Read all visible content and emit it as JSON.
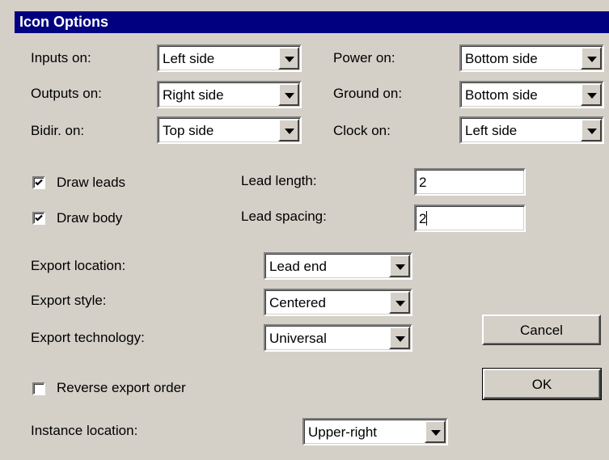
{
  "window": {
    "title": "Icon Options"
  },
  "sides": {
    "inputs": {
      "label": "Inputs on:",
      "value": "Left side"
    },
    "outputs": {
      "label": "Outputs on:",
      "value": "Right side"
    },
    "bidir": {
      "label": "Bidir. on:",
      "value": "Top side"
    },
    "power": {
      "label": "Power on:",
      "value": "Bottom side"
    },
    "ground": {
      "label": "Ground on:",
      "value": "Bottom side"
    },
    "clock": {
      "label": "Clock on:",
      "value": "Left side"
    }
  },
  "leads": {
    "draw_leads": {
      "label": "Draw leads",
      "checked": true
    },
    "draw_body": {
      "label": "Draw body",
      "checked": true
    },
    "lead_length": {
      "label": "Lead length:",
      "value": "2"
    },
    "lead_spacing": {
      "label": "Lead spacing:",
      "value": "2"
    }
  },
  "export": {
    "location": {
      "label": "Export location:",
      "value": "Lead end"
    },
    "style": {
      "label": "Export style:",
      "value": "Centered"
    },
    "technology": {
      "label": "Export technology:",
      "value": "Universal"
    },
    "reverse_order": {
      "label": "Reverse export order",
      "checked": false
    }
  },
  "instance": {
    "location": {
      "label": "Instance location:",
      "value": "Upper-right"
    }
  },
  "buttons": {
    "cancel": "Cancel",
    "ok": "OK"
  },
  "colors": {
    "titlebar": "#000080",
    "face": "#d4d0c8"
  }
}
